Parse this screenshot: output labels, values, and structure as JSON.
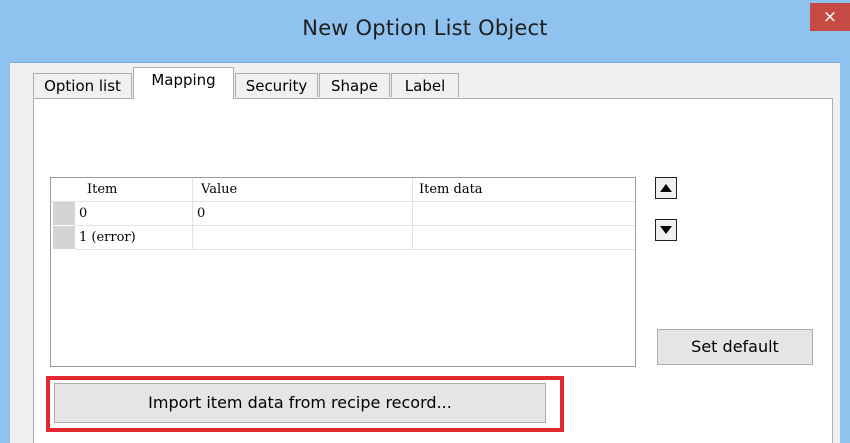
{
  "window": {
    "title": "New  Option List Object",
    "close_label": "×"
  },
  "tabs": [
    {
      "label": "Option list",
      "active": false
    },
    {
      "label": "Mapping",
      "active": true
    },
    {
      "label": "Security",
      "active": false
    },
    {
      "label": "Shape",
      "active": false
    },
    {
      "label": "Label",
      "active": false
    }
  ],
  "mapping_grid": {
    "columns": [
      "Item",
      "Value",
      "Item data"
    ],
    "rows": [
      {
        "item": "0",
        "value": "0",
        "item_data": ""
      },
      {
        "item": "1 (error)",
        "value": "",
        "item_data": ""
      }
    ]
  },
  "buttons": {
    "move_up_icon": "triangle-up",
    "move_down_icon": "triangle-down",
    "set_default": "Set default",
    "import": "Import item data from recipe record..."
  },
  "colors": {
    "title_bar": "#8fc2ef",
    "close_button": "#c74b45",
    "highlight_border": "#e0282e"
  }
}
